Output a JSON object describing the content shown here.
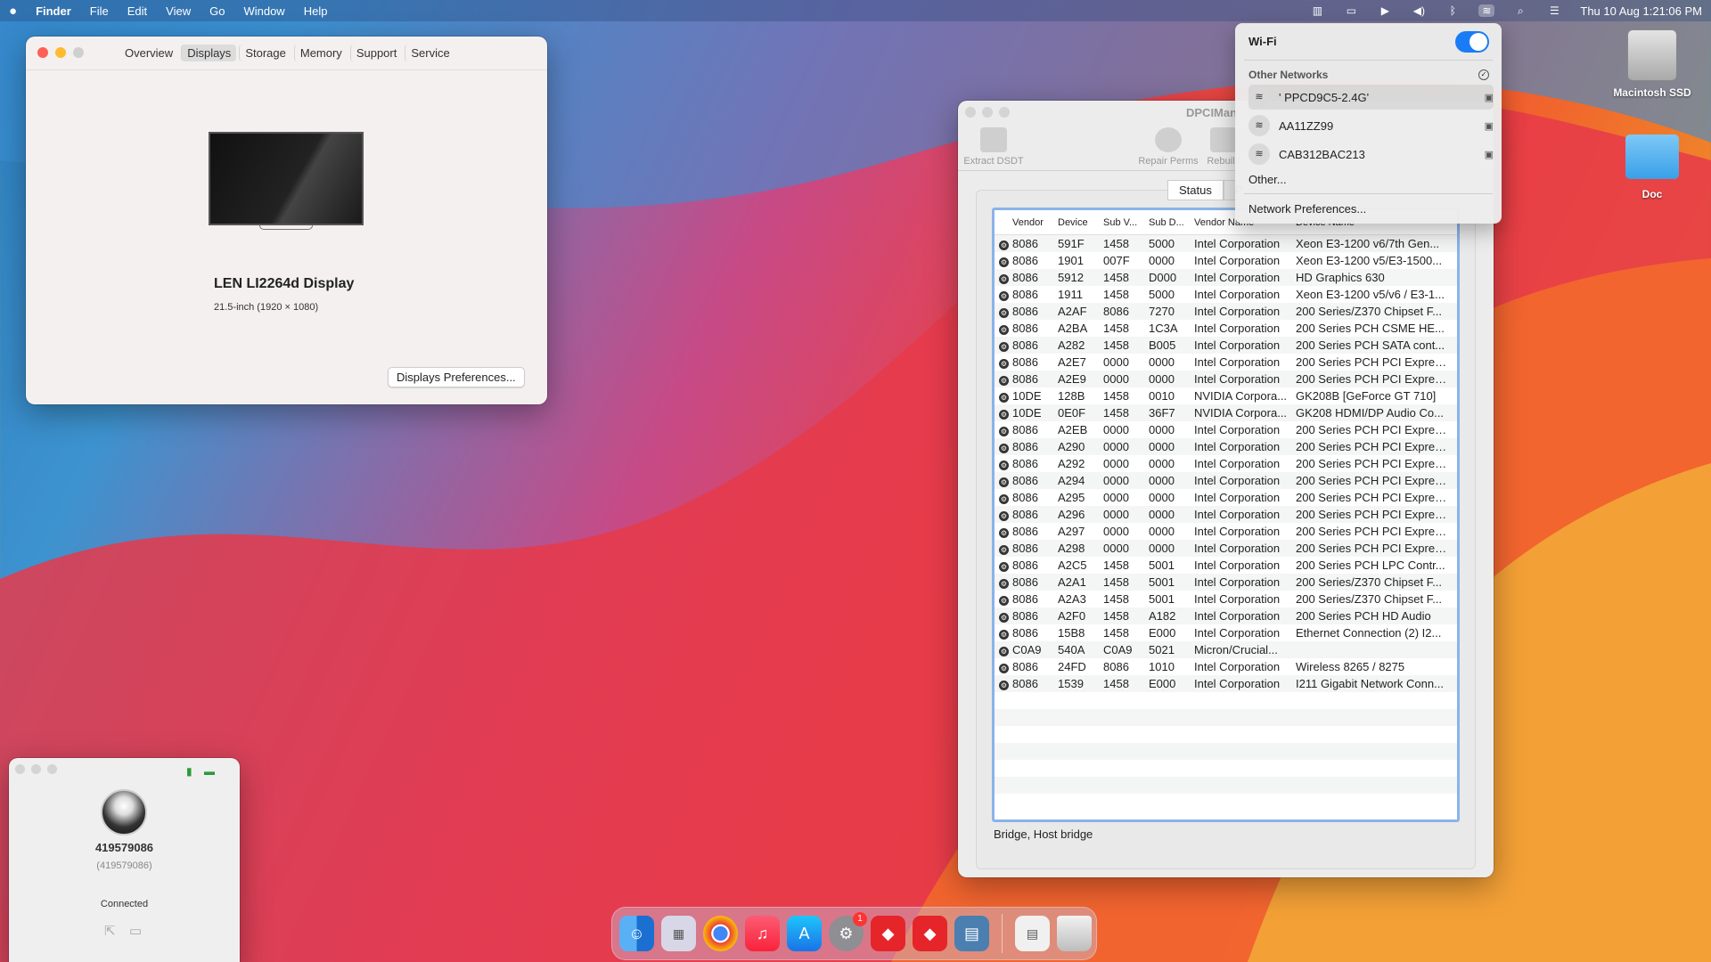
{
  "menubar": {
    "apple": "",
    "app": "Finder",
    "items": [
      "File",
      "Edit",
      "View",
      "Go",
      "Window",
      "Help"
    ],
    "clock": "Thu 10 Aug  1:21:06 PM"
  },
  "about": {
    "tabs": [
      "Overview",
      "Displays",
      "Storage",
      "Memory",
      "Support",
      "Service"
    ],
    "selected_tab": "Displays",
    "display_name": "LEN LI2264d Display",
    "display_size": "21.5-inch (1920 × 1080)",
    "prefs_button": "Displays Preferences..."
  },
  "dpci": {
    "title": "DPCIMan",
    "tools": [
      "Extract DSDT",
      "Repair Perms",
      "Rebuild"
    ],
    "tabs": [
      "Status",
      "P"
    ],
    "columns": [
      "Vendor",
      "Device",
      "Sub V...",
      "Sub D...",
      "Vendor Name",
      "Device Name"
    ],
    "rows": [
      [
        "8086",
        "591F",
        "1458",
        "5000",
        "Intel Corporation",
        "Xeon E3-1200 v6/7th Gen..."
      ],
      [
        "8086",
        "1901",
        "007F",
        "0000",
        "Intel Corporation",
        "Xeon E3-1200 v5/E3-1500..."
      ],
      [
        "8086",
        "5912",
        "1458",
        "D000",
        "Intel Corporation",
        "HD Graphics 630"
      ],
      [
        "8086",
        "1911",
        "1458",
        "5000",
        "Intel Corporation",
        "Xeon E3-1200 v5/v6 / E3-1..."
      ],
      [
        "8086",
        "A2AF",
        "8086",
        "7270",
        "Intel Corporation",
        "200 Series/Z370 Chipset F..."
      ],
      [
        "8086",
        "A2BA",
        "1458",
        "1C3A",
        "Intel Corporation",
        "200 Series PCH CSME HE..."
      ],
      [
        "8086",
        "A282",
        "1458",
        "B005",
        "Intel Corporation",
        "200 Series PCH SATA cont..."
      ],
      [
        "8086",
        "A2E7",
        "0000",
        "0000",
        "Intel Corporation",
        "200 Series PCH PCI Expres..."
      ],
      [
        "8086",
        "A2E9",
        "0000",
        "0000",
        "Intel Corporation",
        "200 Series PCH PCI Expres..."
      ],
      [
        "10DE",
        "128B",
        "1458",
        "0010",
        "NVIDIA Corpora...",
        "GK208B [GeForce GT 710]"
      ],
      [
        "10DE",
        "0E0F",
        "1458",
        "36F7",
        "NVIDIA Corpora...",
        "GK208 HDMI/DP Audio Co..."
      ],
      [
        "8086",
        "A2EB",
        "0000",
        "0000",
        "Intel Corporation",
        "200 Series PCH PCI Expres..."
      ],
      [
        "8086",
        "A290",
        "0000",
        "0000",
        "Intel Corporation",
        "200 Series PCH PCI Expres..."
      ],
      [
        "8086",
        "A292",
        "0000",
        "0000",
        "Intel Corporation",
        "200 Series PCH PCI Expres..."
      ],
      [
        "8086",
        "A294",
        "0000",
        "0000",
        "Intel Corporation",
        "200 Series PCH PCI Expres..."
      ],
      [
        "8086",
        "A295",
        "0000",
        "0000",
        "Intel Corporation",
        "200 Series PCH PCI Expres..."
      ],
      [
        "8086",
        "A296",
        "0000",
        "0000",
        "Intel Corporation",
        "200 Series PCH PCI Expres..."
      ],
      [
        "8086",
        "A297",
        "0000",
        "0000",
        "Intel Corporation",
        "200 Series PCH PCI Expres..."
      ],
      [
        "8086",
        "A298",
        "0000",
        "0000",
        "Intel Corporation",
        "200 Series PCH PCI Expres..."
      ],
      [
        "8086",
        "A2C5",
        "1458",
        "5001",
        "Intel Corporation",
        "200 Series PCH LPC Contr..."
      ],
      [
        "8086",
        "A2A1",
        "1458",
        "5001",
        "Intel Corporation",
        "200 Series/Z370 Chipset F..."
      ],
      [
        "8086",
        "A2A3",
        "1458",
        "5001",
        "Intel Corporation",
        "200 Series/Z370 Chipset F..."
      ],
      [
        "8086",
        "A2F0",
        "1458",
        "A182",
        "Intel Corporation",
        "200 Series PCH HD Audio"
      ],
      [
        "8086",
        "15B8",
        "1458",
        "E000",
        "Intel Corporation",
        "Ethernet Connection (2) I2..."
      ],
      [
        "C0A9",
        "540A",
        "C0A9",
        "5021",
        "Micron/Crucial...",
        ""
      ],
      [
        "8086",
        "24FD",
        "8086",
        "1010",
        "Intel Corporation",
        "Wireless 8265 / 8275"
      ],
      [
        "8086",
        "1539",
        "1458",
        "E000",
        "Intel Corporation",
        "I211 Gigabit Network Conn..."
      ]
    ],
    "status": "Bridge, Host bridge"
  },
  "wifi": {
    "title": "Wi-Fi",
    "section": "Other Networks",
    "networks": [
      "' PPCD9C5-2.4G'",
      "AA11ZZ99",
      "CAB312BAC213"
    ],
    "other": "Other...",
    "prefs": "Network Preferences..."
  },
  "teamviewer": {
    "id": "419579086",
    "sub": "(419579086)",
    "status": "Connected"
  },
  "desktop": {
    "hdd": "Macintosh SSD",
    "folder": "Doc"
  },
  "dock": {
    "badge": "1"
  }
}
